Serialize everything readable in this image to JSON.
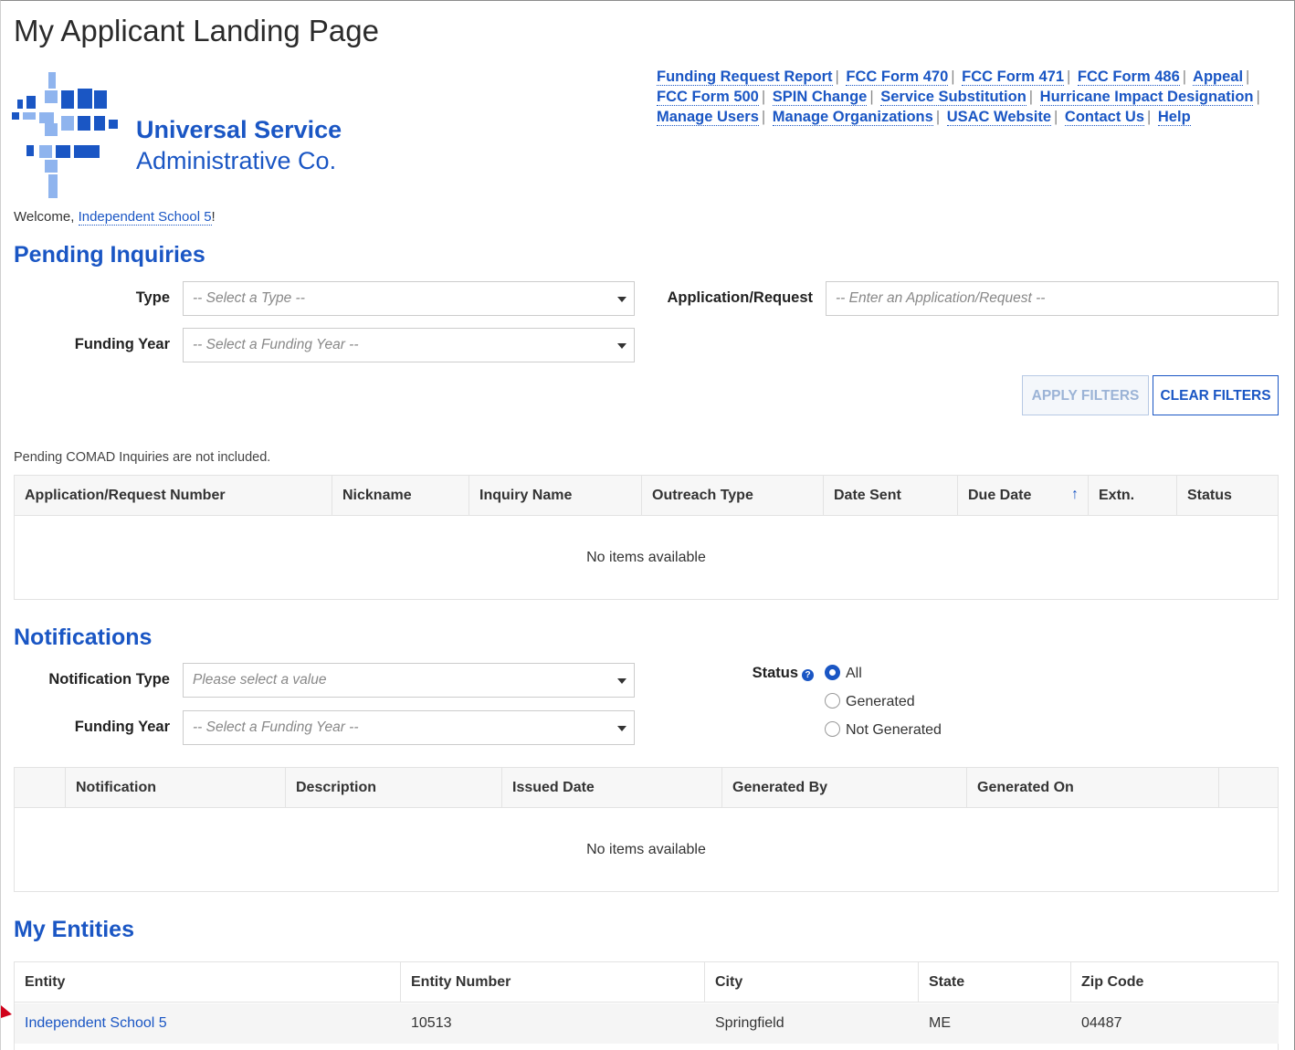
{
  "page": {
    "title": "My Applicant Landing Page"
  },
  "logo": {
    "line1": "Universal Service",
    "line2": "Administrative Co."
  },
  "colors": {
    "brand_blue": "#1a56c4",
    "logo_light": "#8fb4ee",
    "logo_dark": "#1a56c4"
  },
  "top_links": [
    "Funding Request Report",
    "FCC Form 470",
    "FCC Form 471",
    "FCC Form 486",
    "Appeal",
    "FCC Form 500",
    "SPIN Change",
    "Service Substitution",
    "Hurricane Impact Designation",
    "Manage Users",
    "Manage Organizations",
    "USAC Website",
    "Contact Us",
    "Help"
  ],
  "welcome": {
    "prefix": "Welcome, ",
    "name": "Independent School 5",
    "suffix": "!"
  },
  "pending": {
    "title": "Pending Inquiries",
    "type_label": "Type",
    "type_placeholder": "-- Select a Type --",
    "app_label": "Application/Request",
    "app_placeholder": "-- Enter an Application/Request --",
    "fy_label": "Funding Year",
    "fy_placeholder": "-- Select a Funding Year --",
    "apply_label": "APPLY FILTERS",
    "clear_label": "CLEAR FILTERS",
    "note": "Pending COMAD Inquiries are not included.",
    "columns": [
      "Application/Request Number",
      "Nickname",
      "Inquiry Name",
      "Outreach Type",
      "Date Sent",
      "Due Date",
      "Extn.",
      "Status"
    ],
    "sort_icon": "arrow-up-icon",
    "empty": "No items available"
  },
  "notifications": {
    "title": "Notifications",
    "type_label": "Notification Type",
    "type_placeholder": "Please select a value",
    "fy_label": "Funding Year",
    "fy_placeholder": "-- Select a Funding Year --",
    "status_label": "Status",
    "status_options": [
      "All",
      "Generated",
      "Not Generated"
    ],
    "status_selected": "All",
    "columns": [
      "",
      "Notification",
      "Description",
      "Issued Date",
      "Generated By",
      "Generated On",
      ""
    ],
    "empty": "No items available"
  },
  "entities": {
    "title": "My Entities",
    "columns": [
      "Entity",
      "Entity Number",
      "City",
      "State",
      "Zip Code"
    ],
    "rows": [
      {
        "entity": "Independent School 5",
        "number": "10513",
        "city": "Springfield",
        "state": "ME",
        "zip": "04487"
      }
    ]
  }
}
